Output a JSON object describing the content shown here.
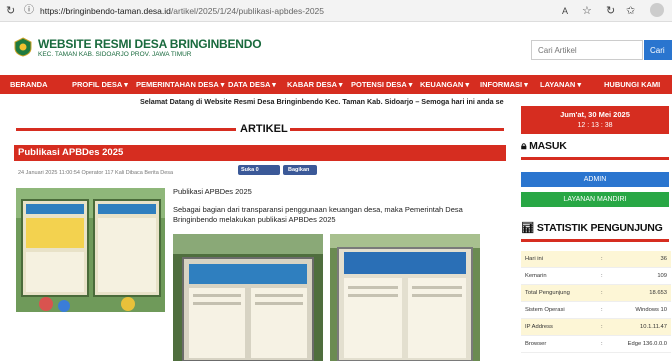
{
  "browser": {
    "url_host": "https://bringinbendo-taman.desa.id",
    "url_path": "/artikel/2025/1/24/publikasi-apbdes-2025"
  },
  "header": {
    "title": "WEBSITE RESMI DESA BRINGINBENDO",
    "subtitle": "KEC. TAMAN KAB. SIDOARJO PROV. JAWA TIMUR",
    "search_placeholder": "Cari Artikel",
    "search_button": "Cari"
  },
  "nav": {
    "items": [
      "BERANDA",
      "PROFIL DESA ▾",
      "PEMERINTAHAN DESA ▾",
      "DATA DESA ▾",
      "KABAR DESA ▾",
      "POTENSI DESA ▾",
      "KEUANGAN ▾",
      "INFORMASI ▾",
      "LAYANAN ▾",
      "HUBUNGI KAMI"
    ]
  },
  "marquee": "Selamat Datang di Website Resmi Desa Bringinbendo Kec. Taman Kab. Sidoarjo – Semoga hari ini anda senantiasa ba",
  "date": {
    "day": "Jum'at, 30 Mei 2025",
    "time": "12 : 13 : 38"
  },
  "section_title": "ARTIKEL",
  "post": {
    "title": "Publikasi APBDes 2025",
    "meta": "24 Januari 2025 11:00:54  Operator  117 Kali Dibaca  Berita Desa",
    "like_label": "Suka 0",
    "share_label": "Bagikan",
    "heading": "Publikasi APBDes 2025",
    "body": "Sebagai bagian dari transparansi penggunaan keuangan desa, maka Pemerintah Desa Bringinbendo melakukan publikasi APBDes 2025"
  },
  "sidebar": {
    "masuk_heading": "MASUK",
    "admin_button": "ADMIN",
    "mandiri_button": "LAYANAN MANDIRI",
    "stat_heading": "STATISTIK PENGUNJUNG",
    "stats": [
      {
        "k": "Hari ini",
        "v": "36"
      },
      {
        "k": "Kemarin",
        "v": "109"
      },
      {
        "k": "Total Pengunjung",
        "v": "18.653"
      },
      {
        "k": "Sistem Operasi",
        "v": "Windows 10"
      },
      {
        "k": "IP Address",
        "v": "10.1.11.47"
      },
      {
        "k": "Browser",
        "v": "Edge 136.0.0.0"
      }
    ]
  },
  "colors": {
    "brand_red": "#d62d20",
    "brand_green": "#196a3d",
    "blue": "#2a75cf",
    "green_btn": "#28a745"
  }
}
